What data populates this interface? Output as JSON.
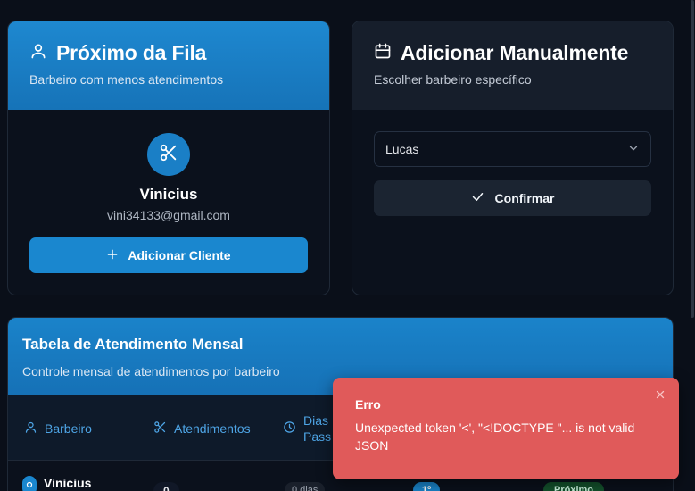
{
  "next_in_queue": {
    "title": "Próximo da Fila",
    "subtitle": "Barbeiro com menos atendimentos",
    "barber_name": "Vinicius",
    "barber_email": "vini34133@gmail.com",
    "add_client_label": "Adicionar Cliente"
  },
  "manual_add": {
    "title": "Adicionar Manualmente",
    "subtitle": "Escolher barbeiro específico",
    "selected_barber": "Lucas",
    "confirm_label": "Confirmar"
  },
  "monthly_table": {
    "title": "Tabela de Atendimento Mensal",
    "subtitle": "Controle mensal de atendimentos por barbeiro",
    "columns": {
      "barber": "Barbeiro",
      "services": "Atendimentos",
      "days_line1": "Dias",
      "days_line2": "Pass"
    },
    "rows": [
      {
        "barber": "Vinicius",
        "services": "0",
        "days": "0 dias",
        "rank": "1º",
        "status": "Próximo"
      }
    ]
  },
  "toast": {
    "title": "Erro",
    "message": "Unexpected token '<', \"<!DOCTYPE \"... is not valid JSON"
  },
  "colors": {
    "accent": "#1a87cf",
    "background": "#0a0f19",
    "error": "#e05a5a"
  }
}
